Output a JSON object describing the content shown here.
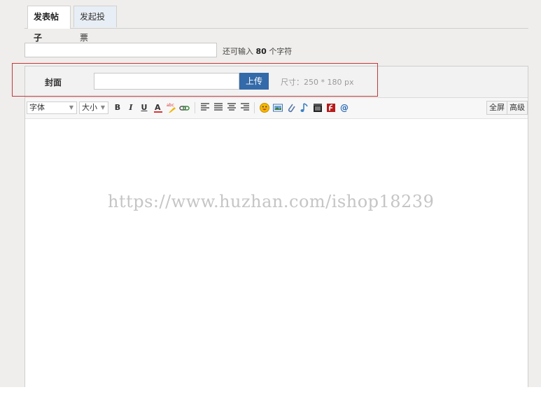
{
  "tabs": [
    {
      "label": "发表帖子",
      "active": true
    },
    {
      "label": "发起投票",
      "active": false
    }
  ],
  "title_input": {
    "value": "",
    "placeholder": ""
  },
  "char_hint": {
    "prefix": "还可输入",
    "count": "80",
    "suffix": "个字符"
  },
  "cover": {
    "label": "封面",
    "input_value": "",
    "upload_label": "上传",
    "size_hint": "尺寸：250 * 180 px"
  },
  "toolbar": {
    "font_select": "字体",
    "size_select": "大小",
    "bold": "B",
    "italic": "I",
    "underline": "U",
    "fullscreen": "全屏",
    "advanced": "高级"
  },
  "watermark": "https://www.huzhan.com/ishop18239",
  "colors": {
    "upload_button": "#336aa9",
    "highlight_border": "#c0393b",
    "page_bg": "#efeeec",
    "tab_inactive_bg": "#e8eef5"
  }
}
